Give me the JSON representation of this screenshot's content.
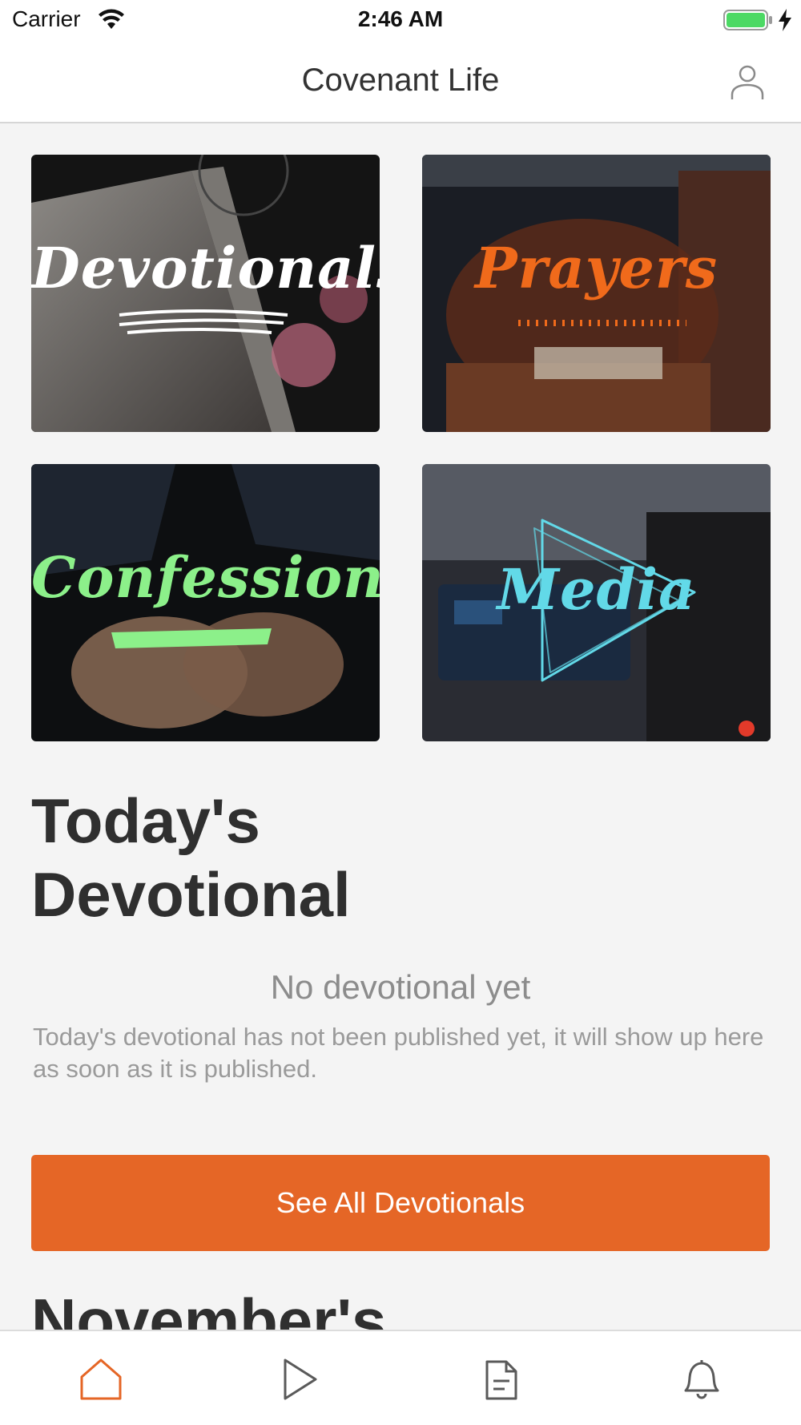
{
  "status_bar": {
    "carrier": "Carrier",
    "time": "2:46 AM"
  },
  "nav": {
    "title": "Covenant Life",
    "profile_icon": "person-icon"
  },
  "tiles": [
    {
      "label": "Devotionals",
      "label_color": "#ffffff"
    },
    {
      "label": "Prayers",
      "label_color": "#f06a1b"
    },
    {
      "label": "Confessions",
      "label_color": "#8cf08a"
    },
    {
      "label": "Media",
      "label_color": "#62d9e8"
    }
  ],
  "today": {
    "heading": "Today's Devotional",
    "empty_title": "No devotional yet",
    "empty_body": "Today's devotional has not been published yet, it will show up here as soon as it is published.",
    "button_label": "See All Devotionals"
  },
  "next_section": {
    "heading": "November's"
  },
  "tab_bar": {
    "items": [
      {
        "icon": "home-icon",
        "active": true
      },
      {
        "icon": "play-icon",
        "active": false
      },
      {
        "icon": "document-icon",
        "active": false
      },
      {
        "icon": "bell-icon",
        "active": false
      }
    ]
  },
  "colors": {
    "accent": "#e56626",
    "background": "#f4f4f4",
    "battery": "#4cd964"
  }
}
